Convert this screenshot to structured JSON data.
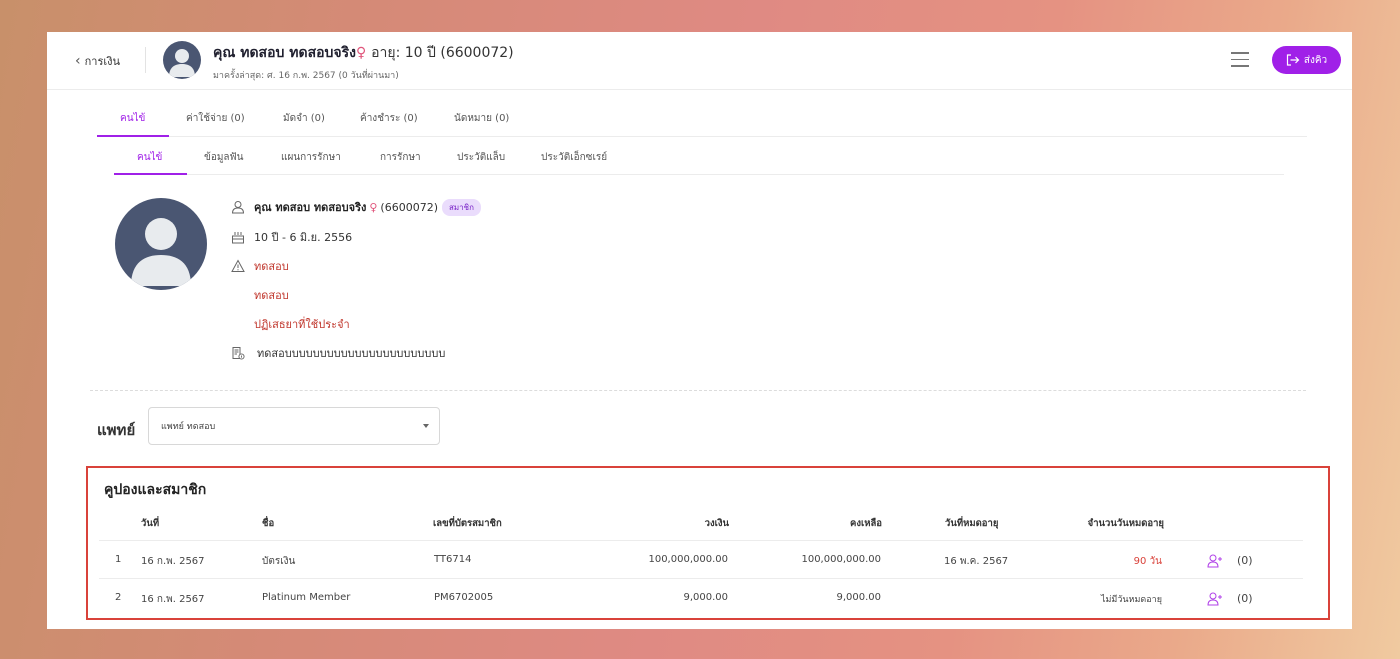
{
  "header": {
    "back_label": "การเงิน",
    "patient_name": "คุณ ทดสอบ ทดสอบจริง",
    "gender_symbol": "♀",
    "age_text": "อายุ: 10 ปี (6600072)",
    "last_visit": "มาครั้งล่าสุด: ศ. 16 ก.พ. 2567 (0 วันที่ผ่านมา)",
    "queue_button": "ส่งคิว"
  },
  "tabs_primary": [
    "คนไข้",
    "ค่าใช้จ่าย (0)",
    "มัดจำ (0)",
    "ค้างชำระ (0)",
    "นัดหมาย (0)"
  ],
  "tabs_secondary": [
    "คนไข้",
    "ข้อมูลฟัน",
    "แผนการรักษา",
    "การรักษา",
    "ประวัติแล็บ",
    "ประวัติเอ็กซเรย์"
  ],
  "profile": {
    "name": "คุณ ทดสอบ ทดสอบจริง",
    "gender_symbol": "♀",
    "code": "(6600072)",
    "member_badge": "สมาชิก",
    "birth": "10 ปี - 6 มิ.ย. 2556",
    "alert_1": "ทดสอบ",
    "alert_2": "ทดสอบ",
    "alert_3": "ปฏิเสธยาที่ใช้ประจำ",
    "note": "ทดสอบบบบบบบบบบบบบบบบบบบบบบบ"
  },
  "doctor": {
    "label": "แพทย์",
    "selected": "แพทย์ ทดสอบ"
  },
  "coupons": {
    "title": "คูปองและสมาชิก",
    "columns": [
      "วันที่",
      "ชื่อ",
      "เลขที่บัตรสมาชิก",
      "วงเงิน",
      "คงเหลือ",
      "วันที่หมดอายุ",
      "จำนวนวันหมดอายุ"
    ],
    "rows": [
      {
        "no": "1",
        "date": "16 ก.พ. 2567",
        "name": "บัตรเงิน",
        "card": "TT6714",
        "limit": "100,000,000.00",
        "balance": "100,000,000.00",
        "expiry": "16 พ.ค. 2567",
        "days_left": "90 วัน",
        "count": "(0)"
      },
      {
        "no": "2",
        "date": "16 ก.พ. 2567",
        "name": "Platinum Member",
        "card": "PM6702005",
        "limit": "9,000.00",
        "balance": "9,000.00",
        "expiry": "",
        "days_left": "ไม่มีวันหมดอายุ",
        "count": "(0)"
      }
    ]
  },
  "colors": {
    "accent": "#a020e8",
    "alert_red": "#c0362c",
    "highlight_border": "#d9423a"
  }
}
